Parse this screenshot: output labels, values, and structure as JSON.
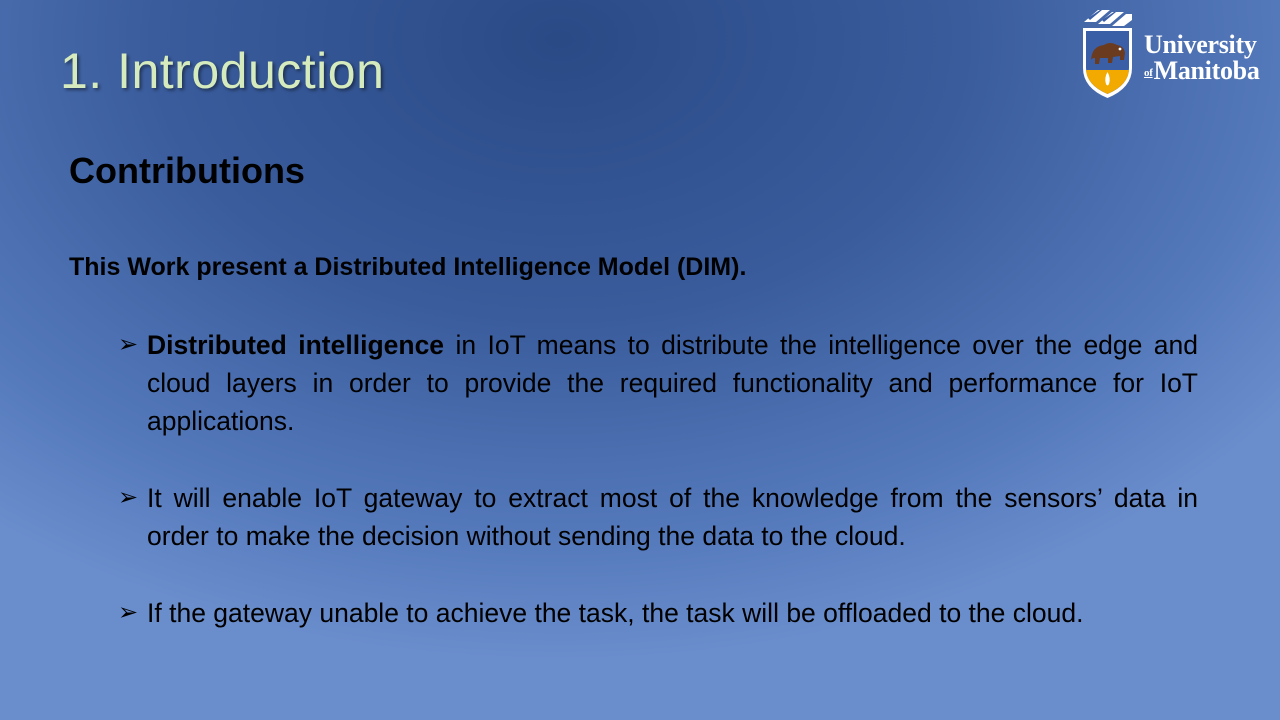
{
  "slide": {
    "title": "1. Introduction",
    "logo": {
      "line1": "University",
      "of": "of",
      "line2": "Manitoba",
      "colors": {
        "shield_blue": "#3b5fa6",
        "shield_gold": "#f2a900",
        "bison_brown": "#6b3b1f"
      }
    },
    "subtitle": "Contributions",
    "intro": "This Work present a Distributed Intelligence Model (DIM).",
    "bullets": [
      {
        "icon": "arrow-bullet-icon",
        "bold_lead": "Distributed intelligence",
        "text": " in IoT means to distribute the intelligence over the edge and cloud layers in order to provide the required functionality and performance for IoT applications."
      },
      {
        "icon": "arrow-bullet-icon",
        "bold_lead": "",
        "text": "It will enable IoT gateway to extract most of the knowledge from the sensors’ data in order to make the decision without sending the data to the cloud."
      },
      {
        "icon": "arrow-bullet-icon",
        "bold_lead": "",
        "text": "If the gateway unable to achieve the task, the task will be offloaded to the cloud."
      }
    ],
    "colors": {
      "title_color": "#d6ebbd",
      "background_dark": "#2a4a86",
      "background_light": "#6a8dcc",
      "text_color": "#000000"
    }
  }
}
